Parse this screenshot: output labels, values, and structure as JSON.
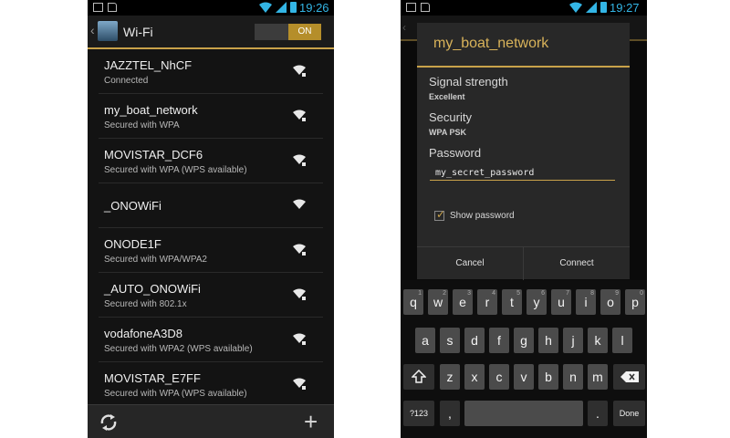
{
  "left_screen": {
    "status_time": "19:26",
    "title": "Wi-Fi",
    "toggle_label": "ON",
    "networks": [
      {
        "name": "JAZZTEL_NhCF",
        "status": "Connected"
      },
      {
        "name": "my_boat_network",
        "status": "Secured with WPA"
      },
      {
        "name": "MOVISTAR_DCF6",
        "status": "Secured with WPA (WPS available)"
      },
      {
        "name": "_ONOWiFi",
        "status": ""
      },
      {
        "name": "ONODE1F",
        "status": "Secured with WPA/WPA2"
      },
      {
        "name": "_AUTO_ONOWiFi",
        "status": "Secured with 802.1x"
      },
      {
        "name": "vodafoneA3D8",
        "status": "Secured with WPA2 (WPS available)"
      },
      {
        "name": "MOVISTAR_E7FF",
        "status": "Secured with WPA (WPS available)"
      }
    ],
    "bottom_icons": [
      "refresh-icon",
      "add-icon"
    ]
  },
  "right_screen": {
    "status_time": "19:27",
    "dialog": {
      "title": "my_boat_network",
      "signal_label": "Signal strength",
      "signal_value": "Excellent",
      "security_label": "Security",
      "security_value": "WPA PSK",
      "password_label": "Password",
      "password_value": "my_secret_password",
      "show_password_label": "Show password",
      "show_password_checked": true,
      "cancel_label": "Cancel",
      "connect_label": "Connect"
    },
    "keyboard": {
      "row1": [
        {
          "k": "q",
          "s": "1"
        },
        {
          "k": "w",
          "s": "2"
        },
        {
          "k": "e",
          "s": "3"
        },
        {
          "k": "r",
          "s": "4"
        },
        {
          "k": "t",
          "s": "5"
        },
        {
          "k": "y",
          "s": "6"
        },
        {
          "k": "u",
          "s": "7"
        },
        {
          "k": "i",
          "s": "8"
        },
        {
          "k": "o",
          "s": "9"
        },
        {
          "k": "p",
          "s": "0"
        }
      ],
      "row2": [
        "a",
        "s",
        "d",
        "f",
        "g",
        "h",
        "j",
        "k",
        "l"
      ],
      "row3": [
        "z",
        "x",
        "c",
        "v",
        "b",
        "n",
        "m"
      ],
      "sym_label": "?123",
      "comma": ",",
      "period": ".",
      "done_label": "Done"
    }
  },
  "colors": {
    "accent": "#c9a24a",
    "status_blue": "#33b5e5",
    "background": "#131313"
  }
}
